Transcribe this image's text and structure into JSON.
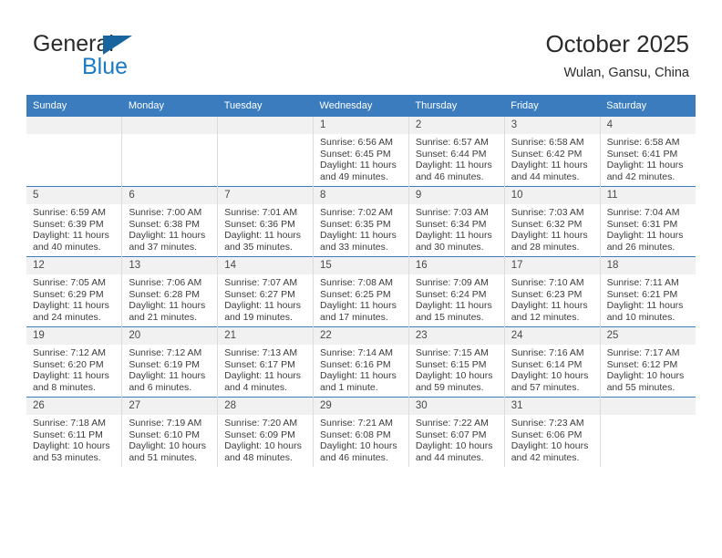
{
  "brand": {
    "name_top": "General",
    "name_bottom": "Blue",
    "triangle_color": "#17649f",
    "blue_text_color": "#1b7ac4"
  },
  "header": {
    "title": "October 2025",
    "subtitle": "Wulan, Gansu, China"
  },
  "theme": {
    "header_blue": "#3a7cbe",
    "daynum_band": "#f1f1f1",
    "row_divider": "#3a7cbe"
  },
  "calendar": {
    "weekday_headers": [
      "Sunday",
      "Monday",
      "Tuesday",
      "Wednesday",
      "Thursday",
      "Friday",
      "Saturday"
    ],
    "weeks": [
      [
        {
          "day": "",
          "empty": true
        },
        {
          "day": "",
          "empty": true
        },
        {
          "day": "",
          "empty": true
        },
        {
          "day": "1",
          "sunrise": "Sunrise: 6:56 AM",
          "sunset": "Sunset: 6:45 PM",
          "daylight": "Daylight: 11 hours and 49 minutes."
        },
        {
          "day": "2",
          "sunrise": "Sunrise: 6:57 AM",
          "sunset": "Sunset: 6:44 PM",
          "daylight": "Daylight: 11 hours and 46 minutes."
        },
        {
          "day": "3",
          "sunrise": "Sunrise: 6:58 AM",
          "sunset": "Sunset: 6:42 PM",
          "daylight": "Daylight: 11 hours and 44 minutes."
        },
        {
          "day": "4",
          "sunrise": "Sunrise: 6:58 AM",
          "sunset": "Sunset: 6:41 PM",
          "daylight": "Daylight: 11 hours and 42 minutes."
        }
      ],
      [
        {
          "day": "5",
          "sunrise": "Sunrise: 6:59 AM",
          "sunset": "Sunset: 6:39 PM",
          "daylight": "Daylight: 11 hours and 40 minutes."
        },
        {
          "day": "6",
          "sunrise": "Sunrise: 7:00 AM",
          "sunset": "Sunset: 6:38 PM",
          "daylight": "Daylight: 11 hours and 37 minutes."
        },
        {
          "day": "7",
          "sunrise": "Sunrise: 7:01 AM",
          "sunset": "Sunset: 6:36 PM",
          "daylight": "Daylight: 11 hours and 35 minutes."
        },
        {
          "day": "8",
          "sunrise": "Sunrise: 7:02 AM",
          "sunset": "Sunset: 6:35 PM",
          "daylight": "Daylight: 11 hours and 33 minutes."
        },
        {
          "day": "9",
          "sunrise": "Sunrise: 7:03 AM",
          "sunset": "Sunset: 6:34 PM",
          "daylight": "Daylight: 11 hours and 30 minutes."
        },
        {
          "day": "10",
          "sunrise": "Sunrise: 7:03 AM",
          "sunset": "Sunset: 6:32 PM",
          "daylight": "Daylight: 11 hours and 28 minutes."
        },
        {
          "day": "11",
          "sunrise": "Sunrise: 7:04 AM",
          "sunset": "Sunset: 6:31 PM",
          "daylight": "Daylight: 11 hours and 26 minutes."
        }
      ],
      [
        {
          "day": "12",
          "sunrise": "Sunrise: 7:05 AM",
          "sunset": "Sunset: 6:29 PM",
          "daylight": "Daylight: 11 hours and 24 minutes."
        },
        {
          "day": "13",
          "sunrise": "Sunrise: 7:06 AM",
          "sunset": "Sunset: 6:28 PM",
          "daylight": "Daylight: 11 hours and 21 minutes."
        },
        {
          "day": "14",
          "sunrise": "Sunrise: 7:07 AM",
          "sunset": "Sunset: 6:27 PM",
          "daylight": "Daylight: 11 hours and 19 minutes."
        },
        {
          "day": "15",
          "sunrise": "Sunrise: 7:08 AM",
          "sunset": "Sunset: 6:25 PM",
          "daylight": "Daylight: 11 hours and 17 minutes."
        },
        {
          "day": "16",
          "sunrise": "Sunrise: 7:09 AM",
          "sunset": "Sunset: 6:24 PM",
          "daylight": "Daylight: 11 hours and 15 minutes."
        },
        {
          "day": "17",
          "sunrise": "Sunrise: 7:10 AM",
          "sunset": "Sunset: 6:23 PM",
          "daylight": "Daylight: 11 hours and 12 minutes."
        },
        {
          "day": "18",
          "sunrise": "Sunrise: 7:11 AM",
          "sunset": "Sunset: 6:21 PM",
          "daylight": "Daylight: 11 hours and 10 minutes."
        }
      ],
      [
        {
          "day": "19",
          "sunrise": "Sunrise: 7:12 AM",
          "sunset": "Sunset: 6:20 PM",
          "daylight": "Daylight: 11 hours and 8 minutes."
        },
        {
          "day": "20",
          "sunrise": "Sunrise: 7:12 AM",
          "sunset": "Sunset: 6:19 PM",
          "daylight": "Daylight: 11 hours and 6 minutes."
        },
        {
          "day": "21",
          "sunrise": "Sunrise: 7:13 AM",
          "sunset": "Sunset: 6:17 PM",
          "daylight": "Daylight: 11 hours and 4 minutes."
        },
        {
          "day": "22",
          "sunrise": "Sunrise: 7:14 AM",
          "sunset": "Sunset: 6:16 PM",
          "daylight": "Daylight: 11 hours and 1 minute."
        },
        {
          "day": "23",
          "sunrise": "Sunrise: 7:15 AM",
          "sunset": "Sunset: 6:15 PM",
          "daylight": "Daylight: 10 hours and 59 minutes."
        },
        {
          "day": "24",
          "sunrise": "Sunrise: 7:16 AM",
          "sunset": "Sunset: 6:14 PM",
          "daylight": "Daylight: 10 hours and 57 minutes."
        },
        {
          "day": "25",
          "sunrise": "Sunrise: 7:17 AM",
          "sunset": "Sunset: 6:12 PM",
          "daylight": "Daylight: 10 hours and 55 minutes."
        }
      ],
      [
        {
          "day": "26",
          "sunrise": "Sunrise: 7:18 AM",
          "sunset": "Sunset: 6:11 PM",
          "daylight": "Daylight: 10 hours and 53 minutes."
        },
        {
          "day": "27",
          "sunrise": "Sunrise: 7:19 AM",
          "sunset": "Sunset: 6:10 PM",
          "daylight": "Daylight: 10 hours and 51 minutes."
        },
        {
          "day": "28",
          "sunrise": "Sunrise: 7:20 AM",
          "sunset": "Sunset: 6:09 PM",
          "daylight": "Daylight: 10 hours and 48 minutes."
        },
        {
          "day": "29",
          "sunrise": "Sunrise: 7:21 AM",
          "sunset": "Sunset: 6:08 PM",
          "daylight": "Daylight: 10 hours and 46 minutes."
        },
        {
          "day": "30",
          "sunrise": "Sunrise: 7:22 AM",
          "sunset": "Sunset: 6:07 PM",
          "daylight": "Daylight: 10 hours and 44 minutes."
        },
        {
          "day": "31",
          "sunrise": "Sunrise: 7:23 AM",
          "sunset": "Sunset: 6:06 PM",
          "daylight": "Daylight: 10 hours and 42 minutes."
        },
        {
          "day": "",
          "empty": true
        }
      ]
    ]
  }
}
